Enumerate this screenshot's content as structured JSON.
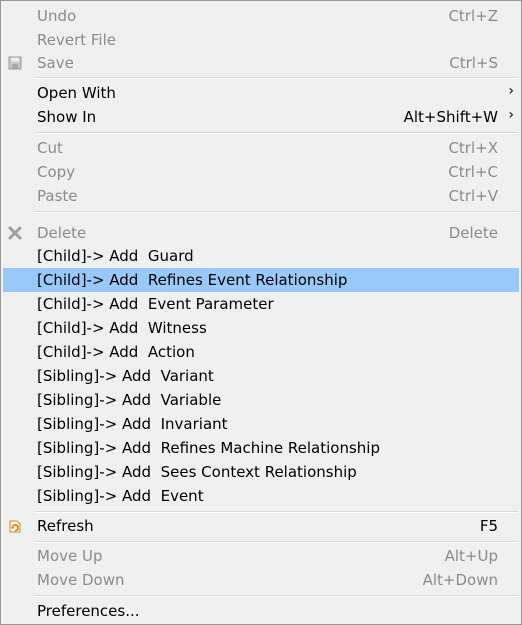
{
  "menu": {
    "undo": {
      "label": "Undo",
      "shortcut": "Ctrl+Z"
    },
    "revert": {
      "label": "Revert File"
    },
    "save": {
      "label": "Save",
      "shortcut": "Ctrl+S"
    },
    "open_with": {
      "label": "Open With"
    },
    "show_in": {
      "label": "Show In",
      "shortcut": "Alt+Shift+W"
    },
    "cut": {
      "label": "Cut",
      "shortcut": "Ctrl+X"
    },
    "copy": {
      "label": "Copy",
      "shortcut": "Ctrl+C"
    },
    "paste": {
      "label": "Paste",
      "shortcut": "Ctrl+V"
    },
    "delete": {
      "label": "Delete",
      "shortcut": "Delete"
    },
    "add_items": [
      "[Child]-> Add  Guard",
      "[Child]-> Add  Refines Event Relationship",
      "[Child]-> Add  Event Parameter",
      "[Child]-> Add  Witness",
      "[Child]-> Add  Action",
      "[Sibling]-> Add  Variant",
      "[Sibling]-> Add  Variable",
      "[Sibling]-> Add  Invariant",
      "[Sibling]-> Add  Refines Machine Relationship",
      "[Sibling]-> Add  Sees Context Relationship",
      "[Sibling]-> Add  Event"
    ],
    "refresh": {
      "label": "Refresh",
      "shortcut": "F5"
    },
    "move_up": {
      "label": "Move Up",
      "shortcut": "Alt+Up"
    },
    "move_down": {
      "label": "Move Down",
      "shortcut": "Alt+Down"
    },
    "preferences": {
      "label": "Preferences..."
    },
    "submenu_arrow": "›"
  },
  "colors": {
    "highlight": "#99c9f7",
    "disabled_text": "#8b8b8b",
    "background": "#f0f0f0"
  },
  "icons": {
    "save": "floppy-disk-icon",
    "delete": "delete-x-icon",
    "refresh": "refresh-icon",
    "submenu": "chevron-right-icon"
  }
}
